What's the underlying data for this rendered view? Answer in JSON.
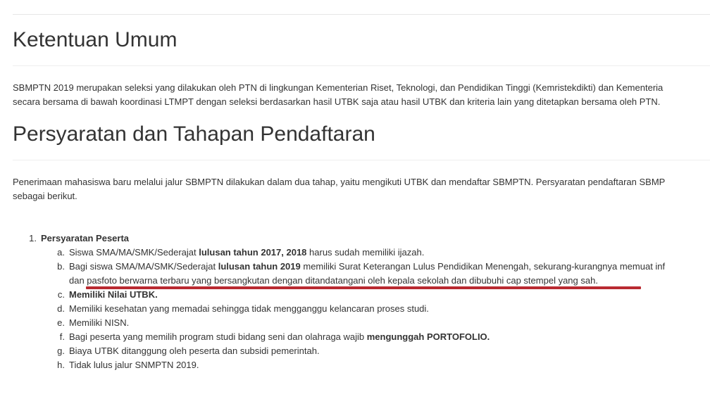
{
  "section1": {
    "title": "Ketentuan Umum",
    "paragraph_line1": "SBMPTN 2019 merupakan seleksi yang dilakukan oleh PTN di lingkungan Kementerian Riset, Teknologi, dan Pendidikan Tinggi (Kemristekdikti) dan Kementeria",
    "paragraph_line2": "secara bersama di bawah koordinasi LTMPT dengan seleksi berdasarkan hasil UTBK saja atau hasil UTBK dan kriteria lain yang ditetapkan bersama oleh PTN."
  },
  "section2": {
    "title": "Persyaratan dan Tahapan Pendaftaran",
    "paragraph_line1": "Penerimaan mahasiswa baru melalui jalur SBMPTN dilakukan dalam dua tahap, yaitu mengikuti UTBK dan mendaftar SBMPTN. Persyaratan pendaftaran SBMP",
    "paragraph_line2": "sebagai berikut."
  },
  "list": {
    "item1": {
      "marker": "1.",
      "label": "Persyaratan Peserta"
    },
    "sub": {
      "a": {
        "marker": "a.",
        "pre": "Siswa SMA/MA/SMK/Sederajat ",
        "bold": "lulusan tahun 2017, 2018",
        "post": " harus sudah memiliki ijazah."
      },
      "b": {
        "marker": "b.",
        "pre": "Bagi siswa SMA/MA/SMK/Sederajat ",
        "bold": "lulusan tahun 2019",
        "post": " memiliki Surat Keterangan Lulus Pendidikan Menengah, sekurang-kurangnya memuat inf",
        "line2": "dan pasfoto berwarna terbaru yang bersangkutan dengan ditandatangani oleh kepala sekolah dan dibubuhi cap stempel yang sah."
      },
      "c": {
        "marker": "c.",
        "bold": "Memiliki Nilai UTBK."
      },
      "d": {
        "marker": "d.",
        "text": "Memiliki kesehatan yang memadai sehingga tidak mengganggu kelancaran proses studi."
      },
      "e": {
        "marker": "e.",
        "text": "Memiliki NISN."
      },
      "f": {
        "marker": "f.",
        "pre": "Bagi peserta yang memilih program studi bidang seni dan olahraga wajib ",
        "bold": "mengunggah PORTOFOLIO."
      },
      "g": {
        "marker": "g.",
        "text": "Biaya UTBK ditanggung oleh peserta dan subsidi pemerintah."
      },
      "h": {
        "marker": "h.",
        "text": "Tidak lulus jalur SNMPTN 2019."
      }
    }
  },
  "colors": {
    "text": "#333333",
    "highlight_underline": "#b92a31"
  }
}
